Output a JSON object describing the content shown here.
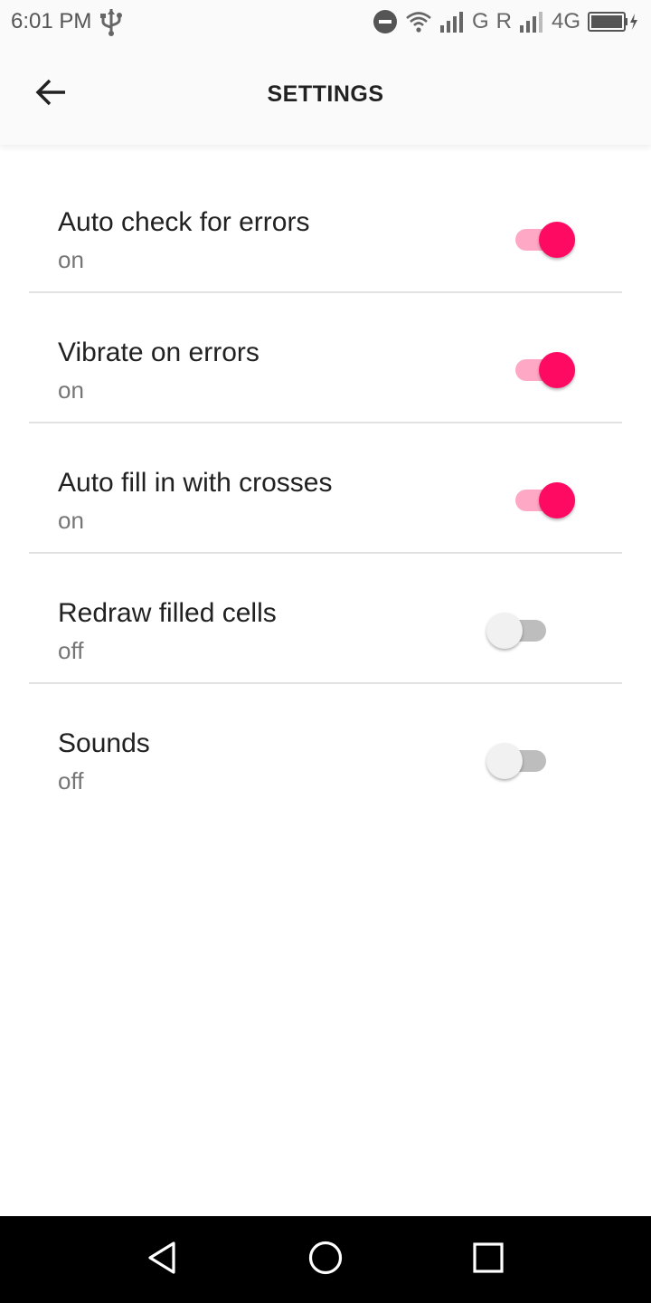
{
  "status_bar": {
    "time": "6:01 PM",
    "network_1": "G",
    "network_2": "R",
    "network_3": "4G"
  },
  "app_bar": {
    "title": "SETTINGS",
    "back_icon": "arrow-back-icon"
  },
  "settings": [
    {
      "title": "Auto check for errors",
      "value": "on",
      "enabled": true
    },
    {
      "title": "Vibrate on errors",
      "value": "on",
      "enabled": true
    },
    {
      "title": "Auto fill in with crosses",
      "value": "on",
      "enabled": true
    },
    {
      "title": "Redraw filled cells",
      "value": "off",
      "enabled": false
    },
    {
      "title": "Sounds",
      "value": "off",
      "enabled": false
    }
  ],
  "colors": {
    "accent": "#ff0a63",
    "accent_track": "#ffa8c6",
    "off_track": "#bdbdbd",
    "off_thumb": "#f1f1f1"
  },
  "nav_bar": {
    "back_icon": "triangle-back-icon",
    "home_icon": "circle-home-icon",
    "recents_icon": "square-recents-icon"
  }
}
